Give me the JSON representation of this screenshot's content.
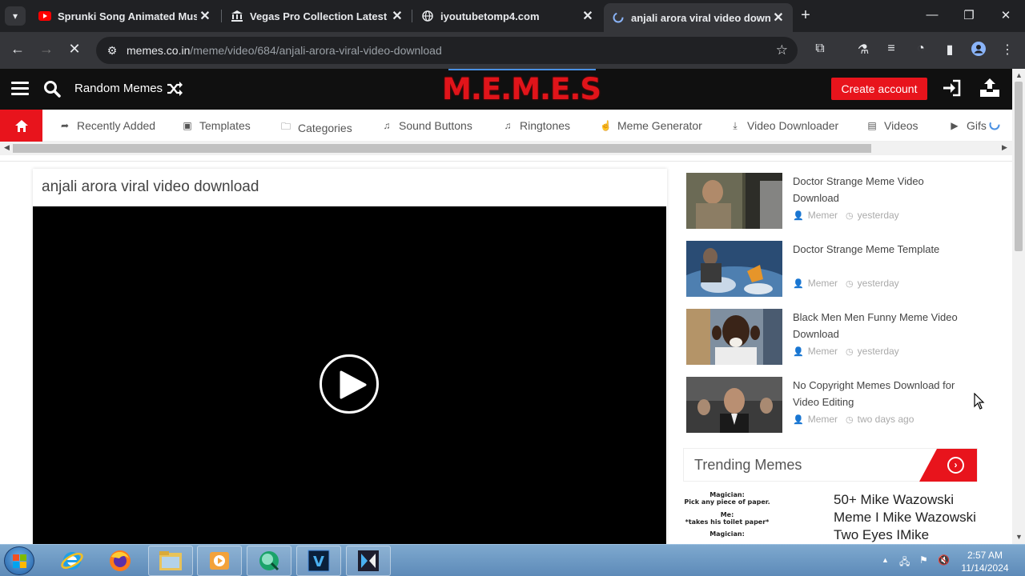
{
  "browser": {
    "tabs": [
      {
        "title": "Sprunki Song Animated Music",
        "icon": "youtube-icon"
      },
      {
        "title": "Vegas Pro Collection Latest Bu",
        "icon": "bank-icon"
      },
      {
        "title": "iyoutubetomp4.com",
        "icon": "globe-icon"
      },
      {
        "title": "anjali arora viral video downlo",
        "icon": "loading-icon",
        "active": true
      }
    ],
    "url_host": "memes.co.in",
    "url_path": "/meme/video/684/anjali-arora-viral-video-download"
  },
  "site": {
    "random_label": "Random Memes",
    "logo": "M.E.M.E.S",
    "create_account": "Create account",
    "nav": [
      "Recently Added",
      "Templates",
      "Categories",
      "Sound Buttons",
      "Ringtones",
      "Meme Generator",
      "Video Downloader",
      "Videos",
      "Gifs"
    ]
  },
  "main": {
    "video_title": "anjali arora viral video download"
  },
  "sidebar": {
    "items": [
      {
        "title": "Doctor Strange Meme Video Download",
        "author": "Memer",
        "time": "yesterday"
      },
      {
        "title": "Doctor Strange Meme Template",
        "author": "Memer",
        "time": "yesterday"
      },
      {
        "title": "Black Men Men Funny Meme Video Download",
        "author": "Memer",
        "time": "yesterday"
      },
      {
        "title": "No Copyright Memes Download for Video Editing",
        "author": "Memer",
        "time": "two days ago"
      }
    ],
    "trending_label": "Trending Memes",
    "trending_item_title": "50+ Mike Wazowski Meme I Mike Wazowski Two Eyes IMike",
    "trending_item_lines": [
      "Magician:",
      "Pick any piece of paper.",
      "Me:",
      "*takes his toilet paper*",
      "Magician:"
    ]
  },
  "taskbar": {
    "time": "2:57 AM",
    "date": "11/14/2024"
  },
  "colors": {
    "brand_red": "#e8141c",
    "header_bg": "#101010",
    "chrome_bg": "#202124"
  }
}
